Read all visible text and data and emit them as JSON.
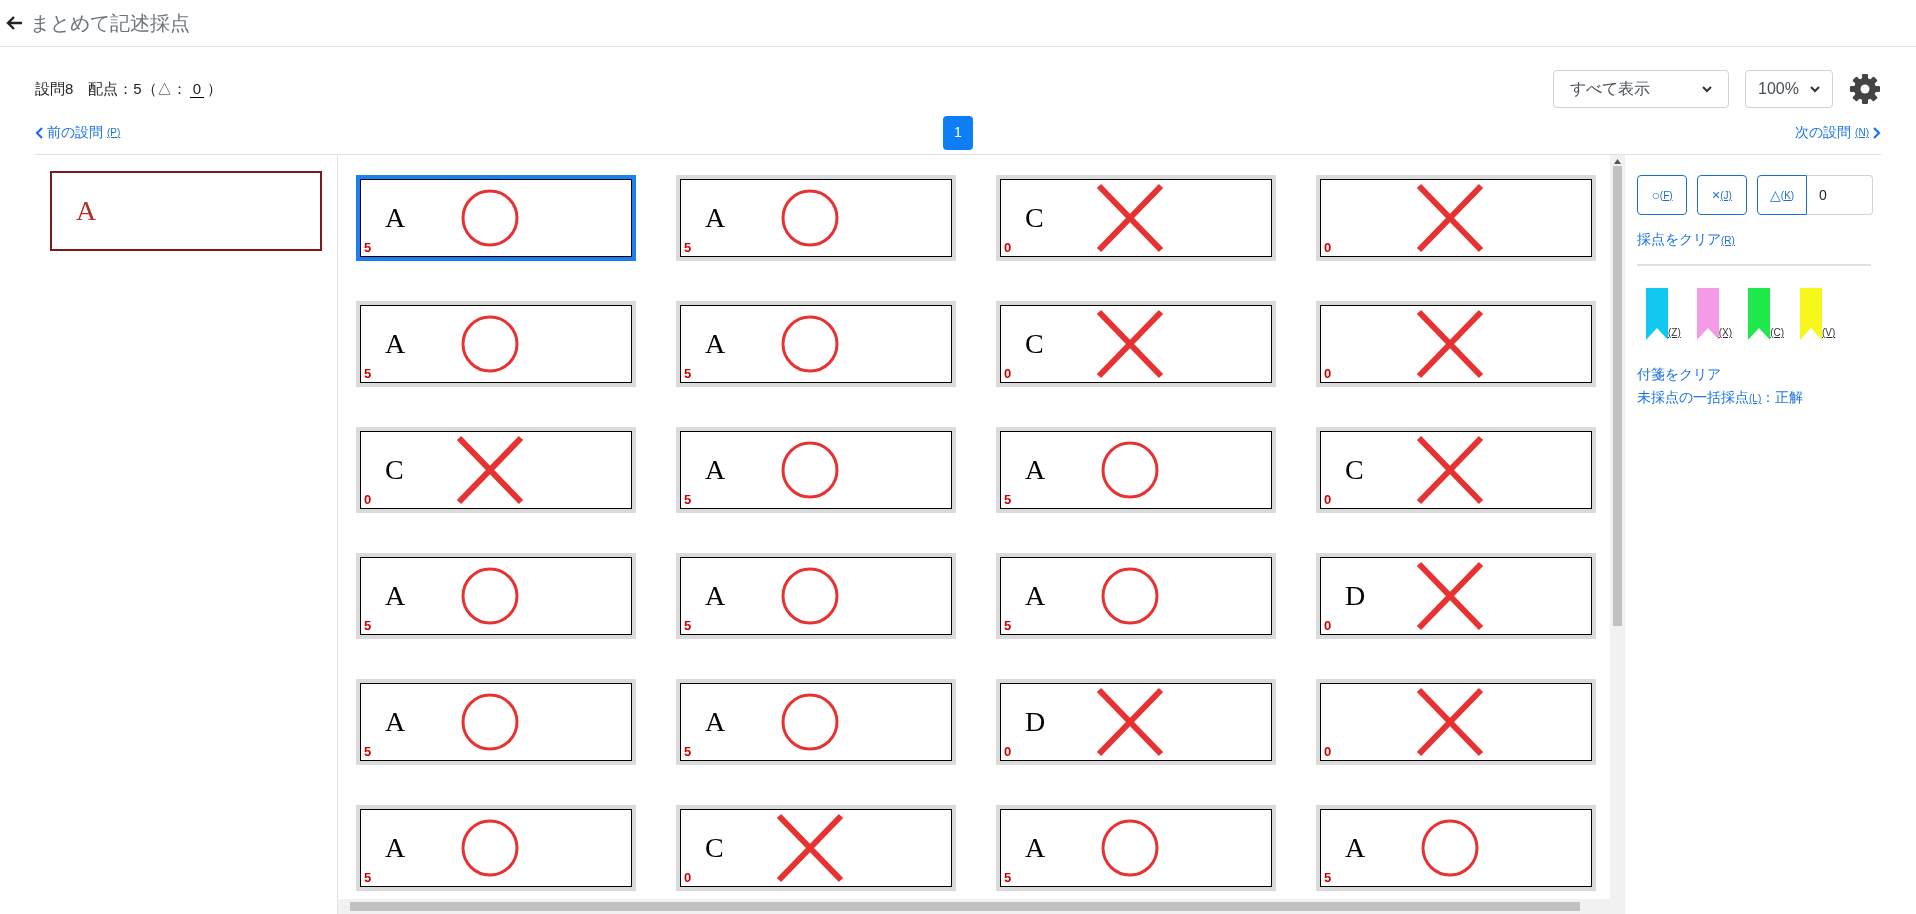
{
  "header": {
    "title": "まとめて記述採点"
  },
  "question": {
    "label": "設問8",
    "points_label": "配点：5（△：",
    "partial_value": "0",
    "close": "）"
  },
  "view_select": {
    "value": "すべて表示"
  },
  "zoom_select": {
    "value": "100%"
  },
  "prev_link": {
    "label": "前の設問",
    "key": "(P)"
  },
  "next_link": {
    "label": "次の設問",
    "key": "(N)"
  },
  "pages": [
    {
      "label": "1",
      "selected": true
    }
  ],
  "model_answer": {
    "text": "A"
  },
  "answers": [
    {
      "text": "A",
      "kind": "circle",
      "score": "5",
      "selected": true
    },
    {
      "text": "A",
      "kind": "circle",
      "score": "5",
      "selected": false
    },
    {
      "text": "C",
      "kind": "cross",
      "score": "0",
      "selected": false
    },
    {
      "kind": "cross",
      "score": "0",
      "selected": false
    },
    {
      "text": "A",
      "kind": "circle",
      "score": "5",
      "selected": false
    },
    {
      "text": "A",
      "kind": "circle",
      "score": "5",
      "selected": false
    },
    {
      "text": "C",
      "kind": "cross",
      "score": "0",
      "selected": false
    },
    {
      "kind": "cross",
      "score": "0",
      "selected": false
    },
    {
      "text": "C",
      "kind": "cross",
      "score": "0",
      "selected": false
    },
    {
      "text": "A",
      "kind": "circle",
      "score": "5",
      "selected": false
    },
    {
      "text": "A",
      "kind": "circle",
      "score": "5",
      "selected": false
    },
    {
      "text": "C",
      "kind": "cross",
      "score": "0",
      "selected": false
    },
    {
      "text": "A",
      "kind": "circle",
      "score": "5",
      "selected": false
    },
    {
      "text": "A",
      "kind": "circle",
      "score": "5",
      "selected": false
    },
    {
      "text": "A",
      "kind": "circle",
      "score": "5",
      "selected": false
    },
    {
      "text": "D",
      "kind": "cross",
      "score": "0",
      "selected": false
    },
    {
      "text": "A",
      "kind": "circle",
      "score": "5",
      "selected": false
    },
    {
      "text": "A",
      "kind": "circle",
      "score": "5",
      "selected": false
    },
    {
      "text": "D",
      "kind": "cross",
      "score": "0",
      "selected": false
    },
    {
      "kind": "cross",
      "score": "0",
      "selected": false
    },
    {
      "text": "A",
      "kind": "circle",
      "score": "5",
      "selected": false
    },
    {
      "text": "C",
      "kind": "cross",
      "score": "0",
      "selected": false
    },
    {
      "text": "A",
      "kind": "circle",
      "score": "5",
      "selected": false
    },
    {
      "text": "A",
      "kind": "circle",
      "score": "5",
      "selected": false
    }
  ],
  "grading": {
    "buttons": [
      {
        "label": "○",
        "key": "(F)"
      },
      {
        "label": "×",
        "key": "(J)"
      },
      {
        "label": "△",
        "key": "(K)"
      }
    ],
    "partial_input": "0",
    "clear_link": {
      "label": "採点をクリア",
      "key": "(R)"
    }
  },
  "tags": [
    {
      "color": "#11c8f0",
      "key": "(Z)"
    },
    {
      "color": "#f49ae6",
      "key": "(X)"
    },
    {
      "color": "#1ee84a",
      "key": "(C)"
    },
    {
      "color": "#f7f71e",
      "key": "(V)"
    }
  ],
  "tag_clear": "付箋をクリア",
  "bulk": {
    "label": "未採点の一括採点",
    "key": "(L)",
    "suffix": "：正解"
  }
}
